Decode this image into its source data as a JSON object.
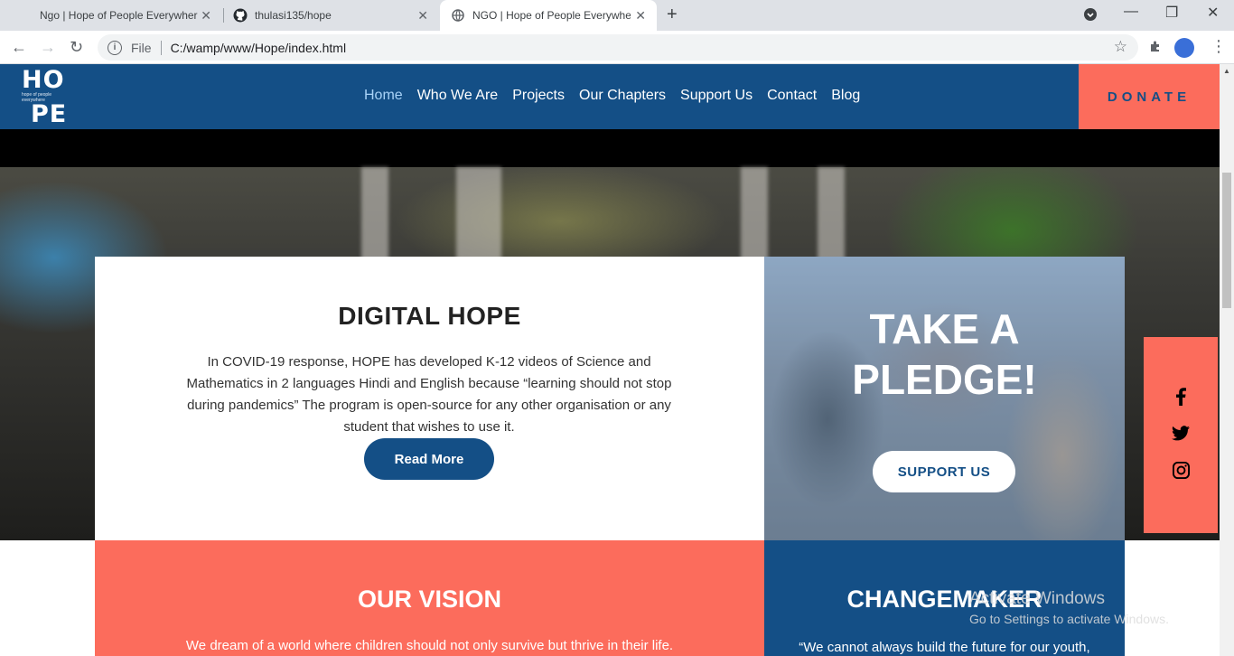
{
  "browser": {
    "tabs": [
      {
        "title": "Ngo | Hope of People Everywhere"
      },
      {
        "title": "thulasi135/hope"
      },
      {
        "title": "NGO | Hope of People Everywhere"
      }
    ],
    "omnibox": {
      "scheme_label": "File",
      "url": "C:/wamp/www/Hope/index.html"
    }
  },
  "site": {
    "logo": {
      "line1": "HO",
      "line2": "PE",
      "tagline": "hope of people everywhere"
    },
    "nav": [
      "Home",
      "Who We Are",
      "Projects",
      "Our Chapters",
      "Support Us",
      "Contact",
      "Blog"
    ],
    "donate_label": "DONATE",
    "digital_hope": {
      "title": "DIGITAL HOPE",
      "text": "In COVID-19 response, HOPE has developed K-12 videos of Science and Mathematics in 2 languages Hindi and English because “learning should not stop during pandemics” The program is open-source for any other organisation or any student that wishes to use it.",
      "button": "Read More"
    },
    "pledge": {
      "line1": "TAKE A",
      "line2": "PLEDGE!",
      "button": "SUPPORT US"
    },
    "social": [
      "facebook-icon",
      "twitter-icon",
      "instagram-icon"
    ],
    "vision": {
      "title": "OUR VISION",
      "text": "We dream of a world where children should not only survive but thrive in their life."
    },
    "changemaker": {
      "title": "CHANGEMAKER",
      "text": "“We cannot always build the future for our youth,"
    }
  },
  "os_watermark": {
    "line1": "Activate Windows",
    "line2": "Go to Settings to activate Windows."
  },
  "colors": {
    "brand_blue": "#144f86",
    "accent_coral": "#fc6c5c"
  }
}
